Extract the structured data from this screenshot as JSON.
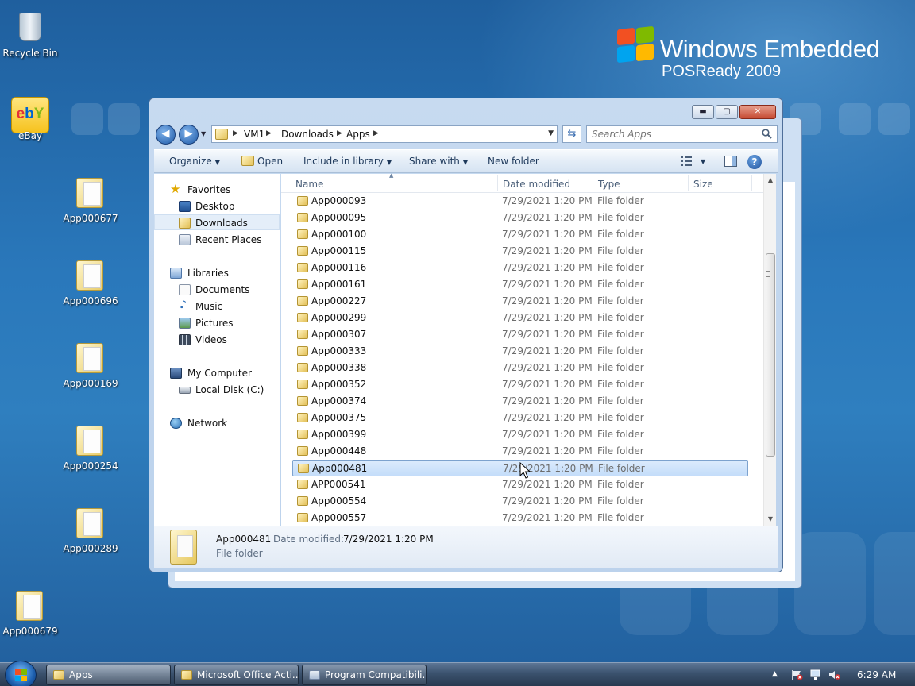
{
  "brand": {
    "title": "Windows Embedded",
    "subtitle": "POSReady 2009"
  },
  "desktop_icons": [
    {
      "label": "Recycle Bin",
      "icon": "recycle-bin-icon"
    },
    {
      "label": "eBay",
      "icon": "ebay-shortcut-icon"
    },
    {
      "label": "App000677",
      "icon": "folder-icon"
    },
    {
      "label": "App000696",
      "icon": "folder-icon"
    },
    {
      "label": "App000169",
      "icon": "folder-icon"
    },
    {
      "label": "App000254",
      "icon": "folder-icon"
    },
    {
      "label": "App000289",
      "icon": "folder-icon"
    },
    {
      "label": "App000679",
      "icon": "folder-icon"
    }
  ],
  "ebay_logo_text": "ebY",
  "explorer": {
    "caption_buttons": {
      "minimize": "▬",
      "maximize": "▢",
      "close": "✕"
    },
    "breadcrumb": [
      "VM1",
      "Downloads",
      "Apps"
    ],
    "search_placeholder": "Search Apps",
    "toolbar": {
      "organize": "Organize",
      "open": "Open",
      "include_in_library": "Include in library",
      "share_with": "Share with",
      "new_folder": "New folder"
    },
    "nav": {
      "favorites": "Favorites",
      "desktop": "Desktop",
      "downloads": "Downloads",
      "recent_places": "Recent Places",
      "libraries": "Libraries",
      "documents": "Documents",
      "music": "Music",
      "pictures": "Pictures",
      "videos": "Videos",
      "my_computer": "My Computer",
      "local_disk": "Local Disk (C:)",
      "network": "Network"
    },
    "columns": {
      "name": "Name",
      "date_modified": "Date modified",
      "type": "Type",
      "size": "Size"
    },
    "rows": [
      {
        "name": "App000093",
        "date": "7/29/2021 1:20 PM",
        "type": "File folder"
      },
      {
        "name": "App000095",
        "date": "7/29/2021 1:20 PM",
        "type": "File folder"
      },
      {
        "name": "App000100",
        "date": "7/29/2021 1:20 PM",
        "type": "File folder"
      },
      {
        "name": "App000115",
        "date": "7/29/2021 1:20 PM",
        "type": "File folder"
      },
      {
        "name": "App000116",
        "date": "7/29/2021 1:20 PM",
        "type": "File folder"
      },
      {
        "name": "App000161",
        "date": "7/29/2021 1:20 PM",
        "type": "File folder"
      },
      {
        "name": "App000227",
        "date": "7/29/2021 1:20 PM",
        "type": "File folder"
      },
      {
        "name": "App000299",
        "date": "7/29/2021 1:20 PM",
        "type": "File folder"
      },
      {
        "name": "App000307",
        "date": "7/29/2021 1:20 PM",
        "type": "File folder"
      },
      {
        "name": "App000333",
        "date": "7/29/2021 1:20 PM",
        "type": "File folder"
      },
      {
        "name": "App000338",
        "date": "7/29/2021 1:20 PM",
        "type": "File folder"
      },
      {
        "name": "App000352",
        "date": "7/29/2021 1:20 PM",
        "type": "File folder"
      },
      {
        "name": "App000374",
        "date": "7/29/2021 1:20 PM",
        "type": "File folder"
      },
      {
        "name": "App000375",
        "date": "7/29/2021 1:20 PM",
        "type": "File folder"
      },
      {
        "name": "App000399",
        "date": "7/29/2021 1:20 PM",
        "type": "File folder"
      },
      {
        "name": "App000448",
        "date": "7/29/2021 1:20 PM",
        "type": "File folder"
      },
      {
        "name": "App000481",
        "date": "7/29/2021 1:20 PM",
        "type": "File folder",
        "selected": true
      },
      {
        "name": "APP000541",
        "date": "7/29/2021 1:20 PM",
        "type": "File folder"
      },
      {
        "name": "App000554",
        "date": "7/29/2021 1:20 PM",
        "type": "File folder"
      },
      {
        "name": "App000557",
        "date": "7/29/2021 1:20 PM",
        "type": "File folder"
      }
    ],
    "details": {
      "name": "App000481",
      "modified_label": "Date modified:",
      "modified_value": "7/29/2021 1:20 PM",
      "type": "File folder"
    }
  },
  "taskbar": {
    "buttons": [
      "Apps",
      "Microsoft Office Acti...",
      "Program Compatibili..."
    ],
    "clock": "6:29 AM"
  },
  "colors": {
    "desktop_blue": "#2a78bb",
    "selection_blue": "#c4ddfa",
    "toolbar_text": "#1e395b",
    "close_red": "#c64a32"
  }
}
